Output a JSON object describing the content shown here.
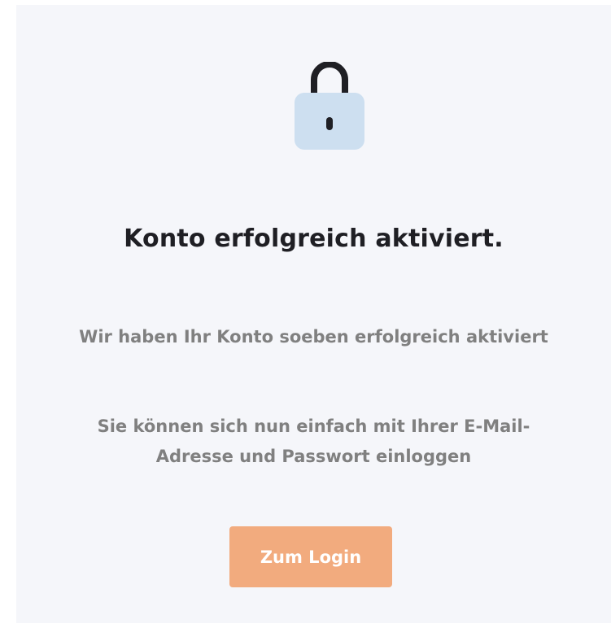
{
  "icon": "unlocked-padlock-icon",
  "colors": {
    "card_background": "#f5f6fa",
    "lock_body": "#cddff0",
    "lock_shackle": "#1f1f24",
    "button_background": "#f2ab7e",
    "button_text": "#ffffff",
    "title_text": "#1f1f24",
    "message_text": "#808080"
  },
  "heading": "Konto erfolgreich aktiviert.",
  "messages": {
    "activated": "Wir haben Ihr Konto soeben erfolgreich aktiviert",
    "login_hint": "Sie können sich nun einfach mit Ihrer E-Mail-Adresse und Passwort einloggen"
  },
  "button": {
    "label": "Zum Login"
  }
}
